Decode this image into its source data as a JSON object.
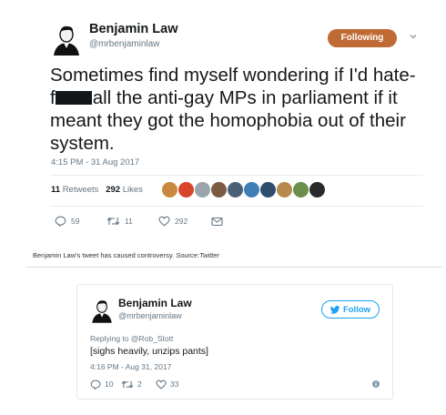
{
  "main_tweet": {
    "name": "Benjamin Law",
    "handle": "@mrbenjaminlaw",
    "follow_label": "Following",
    "text_line1": "Sometimes find myself wondering if I'd hate-",
    "text_line2_prefix": "f",
    "text_line2_rest": "all the anti-gay MPs in parliament if it",
    "text_line3": "meant they got the homophobia out of their",
    "text_line4": "system.",
    "timestamp": "4:15 PM - 31 Aug 2017",
    "retweets_count": "11",
    "retweets_label": "Retweets",
    "likes_count": "292",
    "likes_label": "Likes",
    "reply_count": "59",
    "retweet_count": "11",
    "like_count": "292",
    "liker_colors": [
      "#c8893e",
      "#d8452c",
      "#9aa5ab",
      "#7d5a42",
      "#4a6078",
      "#3e7fb6",
      "#2f4e6e",
      "#b58a4c",
      "#6b8f4a",
      "#2a2a2a"
    ]
  },
  "caption": {
    "text": "Benjamin Law's tweet has caused controversy.",
    "source_label": "Source:",
    "source_name": "Twitter"
  },
  "embedded_tweet": {
    "name": "Benjamin Law",
    "handle": "@mrbenjaminlaw",
    "follow_label": "Follow",
    "replying_to": "Replying to @Rob_Stott",
    "text": "[sighs heavily, unzips pants]",
    "timestamp": "4:16 PM - Aug 31, 2017",
    "reply_count": "10",
    "retweet_count": "2",
    "like_count": "33"
  },
  "colors": {
    "following_bg": "#c06a36",
    "twitter_blue": "#1da1f2",
    "secondary_text": "#657786"
  }
}
